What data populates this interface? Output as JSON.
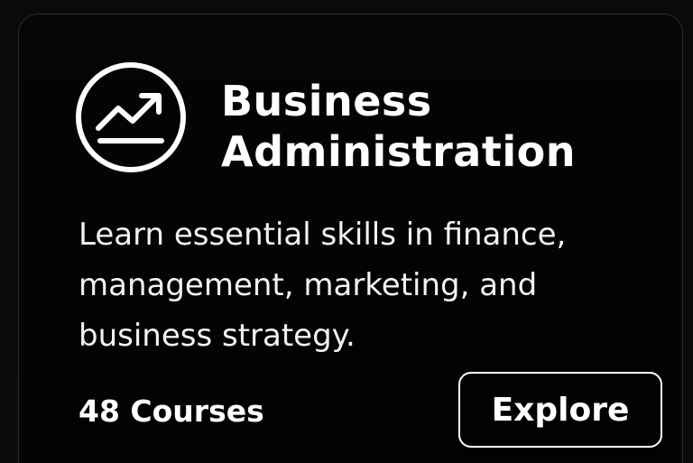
{
  "card": {
    "icon": "trending-up-chart-icon",
    "title_line1": "Business",
    "title_line2": "Administration",
    "description_line1": "Learn essential skills in finance,",
    "description_line2": "management, marketing, and",
    "description_line3": "business strategy.",
    "course_count": "48 Courses",
    "explore_label": "Explore"
  },
  "colors": {
    "background": "#0a0a0a",
    "card_background": "#050505",
    "card_border": "#2a2a2a",
    "text": "#ffffff"
  }
}
